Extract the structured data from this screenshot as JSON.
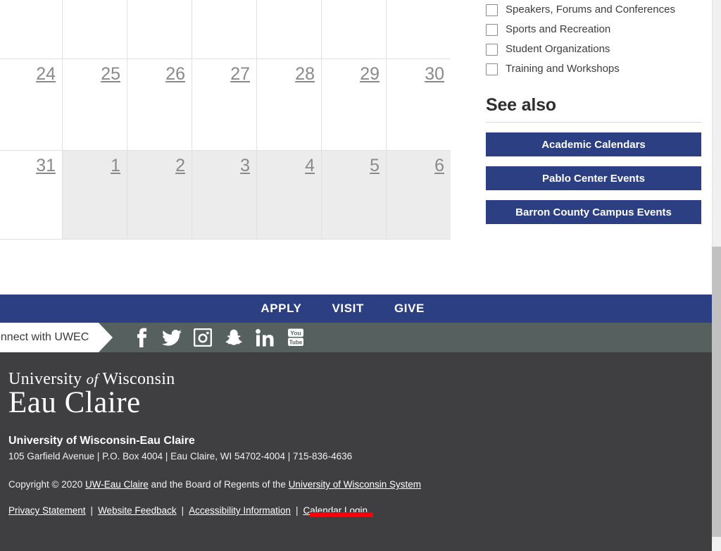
{
  "calendar": {
    "rows": [
      {
        "days": [
          "",
          "",
          "",
          "",
          "",
          "",
          ""
        ],
        "other_month": [
          false,
          false,
          false,
          false,
          false,
          false,
          false
        ]
      },
      {
        "days": [
          "24",
          "25",
          "26",
          "27",
          "28",
          "29",
          "30"
        ],
        "other_month": [
          false,
          false,
          false,
          false,
          false,
          false,
          false
        ]
      },
      {
        "days": [
          "31",
          "1",
          "2",
          "3",
          "4",
          "5",
          "6"
        ],
        "other_month": [
          false,
          true,
          true,
          true,
          true,
          true,
          true
        ]
      }
    ]
  },
  "sidebar": {
    "filters": [
      {
        "label": "Speakers, Forums and Conferences",
        "checked": false
      },
      {
        "label": "Sports and Recreation",
        "checked": false
      },
      {
        "label": "Student Organizations",
        "checked": false
      },
      {
        "label": "Training and Workshops",
        "checked": false
      }
    ],
    "see_also_heading": "See also",
    "buttons": [
      "Academic Calendars",
      "Pablo Center Events",
      "Barron County Campus Events"
    ],
    "accent_color": "#2b3f82"
  },
  "action_bar": {
    "links": [
      "APPLY",
      "VISIT",
      "GIVE"
    ],
    "background": "#2b3f82"
  },
  "social_bar": {
    "connect_label": "onnect with UWEC",
    "background": "#56605e",
    "icons": [
      {
        "name": "facebook-icon",
        "label": "Facebook"
      },
      {
        "name": "twitter-icon",
        "label": "Twitter"
      },
      {
        "name": "instagram-icon",
        "label": "Instagram"
      },
      {
        "name": "snapchat-icon",
        "label": "Snapchat"
      },
      {
        "name": "linkedin-icon",
        "label": "LinkedIn"
      },
      {
        "name": "youtube-icon",
        "label": "YouTube"
      }
    ]
  },
  "footer": {
    "logo_line1_pre": "University",
    "logo_line1_italic": "of",
    "logo_line1_post": "Wisconsin",
    "logo_line2": "Eau Claire",
    "org_name": "University of Wisconsin-Eau Claire",
    "address": "105 Garfield Avenue | P.O. Box 4004 | Eau Claire, WI 54702-4004 | 715-836-4636",
    "copyright_pre": "Copyright © 2020 ",
    "copyright_link1": "UW-Eau Claire",
    "copyright_mid": " and the Board of Regents of the ",
    "copyright_link2": "University of Wisconsin System",
    "legal_links": [
      "Privacy Statement",
      "Website Feedback",
      "Accessibility Information",
      "Calendar Login"
    ],
    "separator": "|",
    "background": "#3f3f41",
    "highlight_color": "#fb0007"
  }
}
